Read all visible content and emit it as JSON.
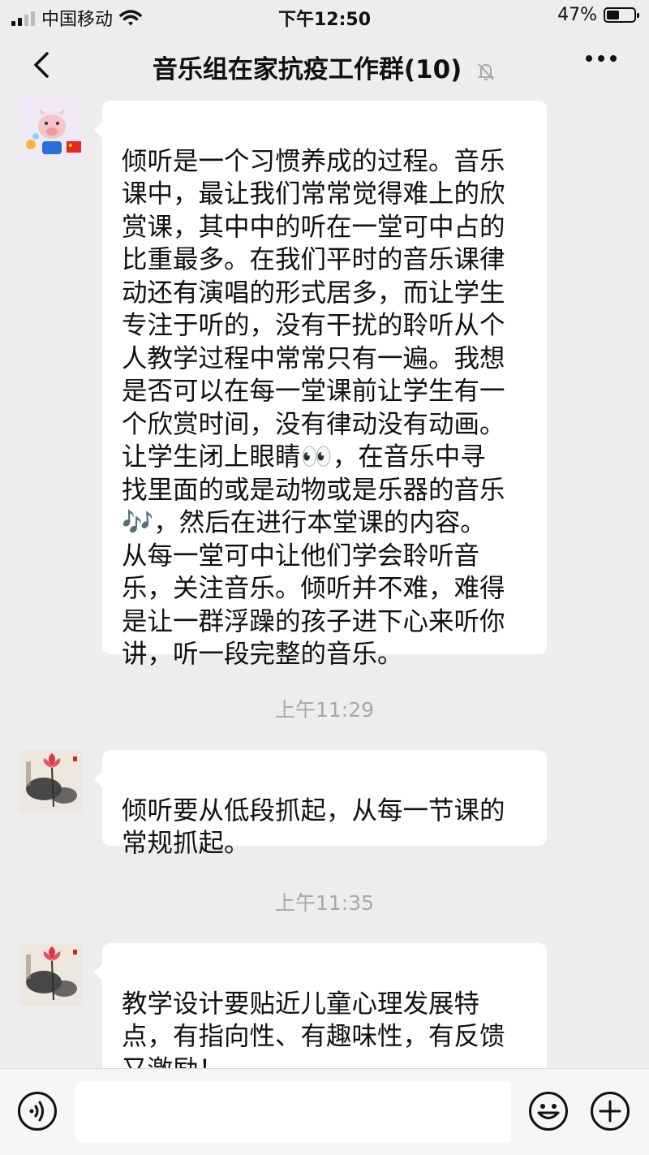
{
  "status_bar": {
    "carrier": "中国移动",
    "time": "下午12:50",
    "battery_percent": "47%",
    "battery_level": 0.47
  },
  "header": {
    "title": "音乐组在家抗疫工作群(10)",
    "back_icon": "chevron-left-icon",
    "muted_icon": "bell-slash-icon",
    "more_icon": "more-dots-icon"
  },
  "messages": [
    {
      "avatar": "pig-avatar",
      "text": "倾听是一个习惯养成的过程。音乐\n课中，最让我们常常觉得难上的欣\n赏课，其中中的听在一堂可中占的\n比重最多。在我们平时的音乐课律\n动还有演唱的形式居多，而让学生\n专注于听的，没有干扰的聆听从个\n人教学过程中常常只有一遍。我想\n是否可以在每一堂课前让学生有一\n个欣赏时间，没有律动没有动画。\n让学生闭上眼睛👀，在音乐中寻\n找里面的或是动物或是乐器的音乐\n🎶，然后在进行本堂课的内容。\n从每一堂可中让他们学会聆听音\n乐，关注音乐。倾听并不难，难得\n是让一群浮躁的孩子进下心来听你\n讲，听一段完整的音乐。"
    },
    {
      "timestamp": "上午11:29",
      "avatar": "lotus-painting-avatar",
      "text": "倾听要从低段抓起，从每一节课的\n常规抓起。"
    },
    {
      "timestamp": "上午11:35",
      "avatar": "lotus-painting-avatar",
      "text": "教学设计要贴近儿童心理发展特\n点，有指向性、有趣味性，有反馈\n又激励！"
    }
  ],
  "input_bar": {
    "voice_icon": "voice-icon",
    "input_value": "",
    "emoji_icon": "emoji-icon",
    "add_icon": "plus-circle-icon"
  },
  "colors": {
    "background": "#ededed",
    "bubble": "#ffffff",
    "timestamp": "#a8a8a8"
  }
}
